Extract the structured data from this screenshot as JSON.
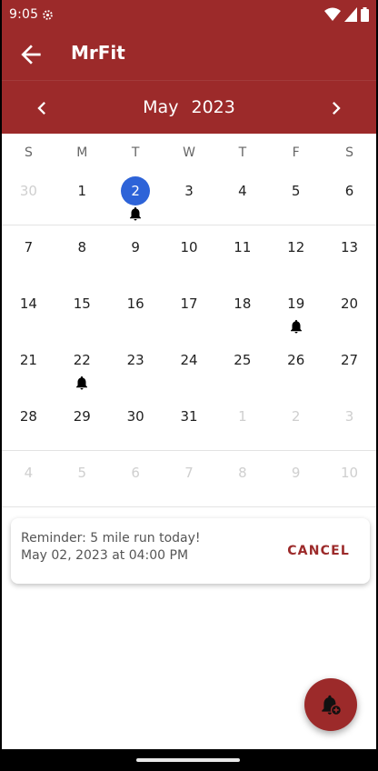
{
  "status_bar": {
    "time": "9:05",
    "icons": [
      "settings-gear-icon",
      "wifi-icon",
      "signal-icon",
      "battery-icon"
    ]
  },
  "app_bar": {
    "title": "MrFit",
    "back_icon": "arrow-back-icon",
    "background": "#9c2a2a"
  },
  "calendar": {
    "month": "May",
    "year": "2023",
    "prev_icon": "chevron-left-icon",
    "next_icon": "chevron-right-icon",
    "weekdays": [
      "S",
      "M",
      "T",
      "W",
      "T",
      "F",
      "S"
    ],
    "selected_color": "#2d63d8",
    "weeks": [
      [
        {
          "n": "30",
          "muted": true
        },
        {
          "n": "1"
        },
        {
          "n": "2",
          "selected": true,
          "reminder": true
        },
        {
          "n": "3"
        },
        {
          "n": "4"
        },
        {
          "n": "5"
        },
        {
          "n": "6"
        }
      ],
      [
        {
          "n": "7"
        },
        {
          "n": "8"
        },
        {
          "n": "9"
        },
        {
          "n": "10"
        },
        {
          "n": "11"
        },
        {
          "n": "12"
        },
        {
          "n": "13"
        }
      ],
      [
        {
          "n": "14"
        },
        {
          "n": "15"
        },
        {
          "n": "16"
        },
        {
          "n": "17"
        },
        {
          "n": "18"
        },
        {
          "n": "19",
          "reminder": true
        },
        {
          "n": "20"
        }
      ],
      [
        {
          "n": "21"
        },
        {
          "n": "22",
          "reminder": true
        },
        {
          "n": "23"
        },
        {
          "n": "24"
        },
        {
          "n": "25"
        },
        {
          "n": "26"
        },
        {
          "n": "27"
        }
      ],
      [
        {
          "n": "28"
        },
        {
          "n": "29"
        },
        {
          "n": "30"
        },
        {
          "n": "31"
        },
        {
          "n": "1",
          "muted": true
        },
        {
          "n": "2",
          "muted": true
        },
        {
          "n": "3",
          "muted": true
        }
      ],
      [
        {
          "n": "4",
          "muted": true
        },
        {
          "n": "5",
          "muted": true
        },
        {
          "n": "6",
          "muted": true
        },
        {
          "n": "7",
          "muted": true
        },
        {
          "n": "8",
          "muted": true
        },
        {
          "n": "9",
          "muted": true
        },
        {
          "n": "10",
          "muted": true
        }
      ]
    ]
  },
  "reminder": {
    "title": "Reminder:  5 mile run today!",
    "datetime": "May 02, 2023 at 04:00 PM",
    "cancel_label": "CANCEL",
    "accent": "#9c2a2a"
  },
  "fab": {
    "icon": "add-alarm-bell-icon"
  }
}
